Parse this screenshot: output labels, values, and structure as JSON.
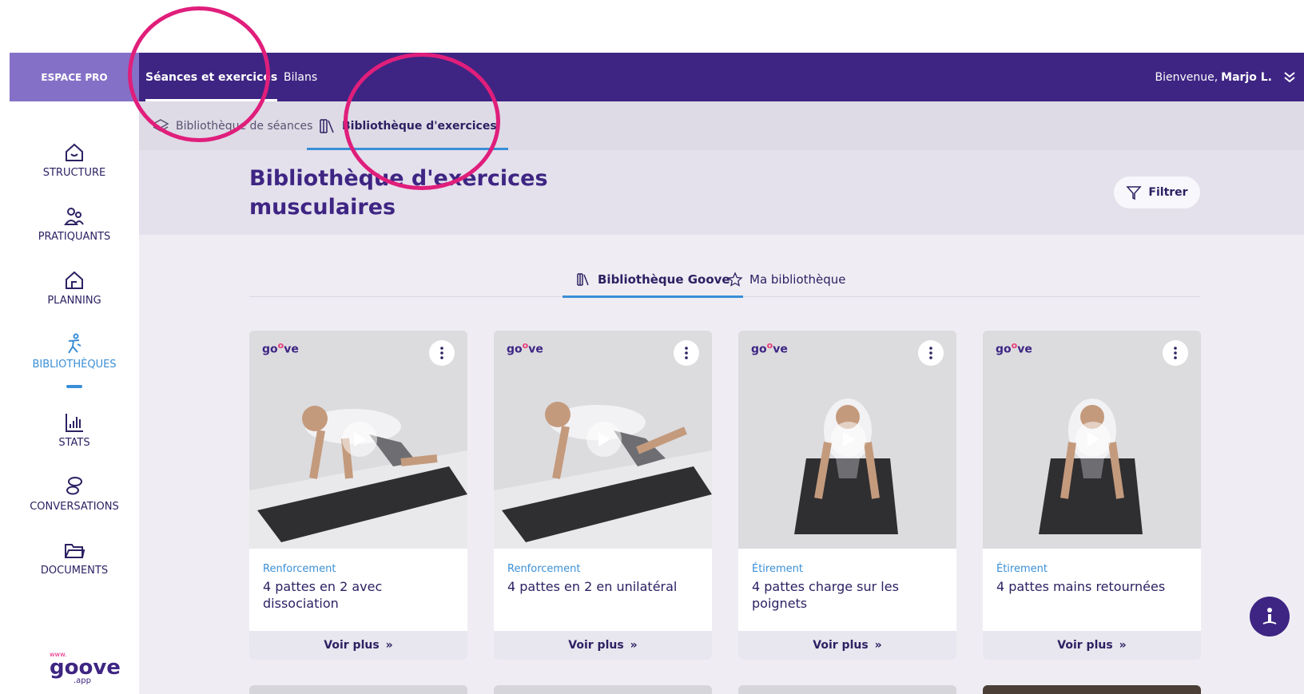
{
  "topbar": {
    "espace_label": "ESPACE PRO",
    "tabs": [
      {
        "label": "Séances et exercices",
        "active": true
      },
      {
        "label": "Bilans",
        "active": false
      }
    ],
    "welcome_prefix": "Bienvenue,",
    "user_name": "Marjo L."
  },
  "sidebar": {
    "items": [
      {
        "label": "STRUCTURE",
        "icon": "home-heart-icon"
      },
      {
        "label": "PRATIQUANTS",
        "icon": "users-icon"
      },
      {
        "label": "PLANNING",
        "icon": "house-calendar-icon"
      },
      {
        "label": "BIBLIOTHÈQUES",
        "icon": "running-person-icon",
        "active": true
      },
      {
        "label": "STATS",
        "icon": "bar-chart-icon"
      },
      {
        "label": "CONVERSATIONS",
        "icon": "chat-bubbles-icon"
      },
      {
        "label": "DOCUMENTS",
        "icon": "folder-icon"
      }
    ],
    "logo": {
      "www": "www.",
      "brand": "goove",
      "domain": ".app"
    }
  },
  "subnav": {
    "items": [
      {
        "label": "Bibliothèque de séances",
        "icon": "layers-icon"
      },
      {
        "label": "Bibliothèque d'exercices",
        "icon": "books-icon",
        "active": true
      }
    ]
  },
  "page": {
    "title": "Bibliothèque d'exercices musculaires",
    "filter_label": "Filtrer"
  },
  "library_tabs": [
    {
      "label": "Bibliothèque Goove",
      "icon": "books-icon",
      "active": true
    },
    {
      "label": "Ma bibliothèque",
      "icon": "star-icon"
    }
  ],
  "cards": [
    {
      "category": "Renforcement",
      "title": "4 pattes en 2 avec dissociation",
      "more": "Voir plus"
    },
    {
      "category": "Renforcement",
      "title": "4 pattes en 2 en unilatéral",
      "more": "Voir plus"
    },
    {
      "category": "Étirement",
      "title": "4 pattes charge sur les poignets",
      "more": "Voir plus"
    },
    {
      "category": "Étirement",
      "title": "4 pattes mains retournées",
      "more": "Voir plus"
    }
  ],
  "thumb_logo": "go",
  "thumb_logo_sup": "o",
  "thumb_logo_end": "ve",
  "colors": {
    "primary": "#3e2583",
    "accent": "#3a8fd6",
    "annotation": "#e01e7b",
    "espace": "#8471c7"
  }
}
